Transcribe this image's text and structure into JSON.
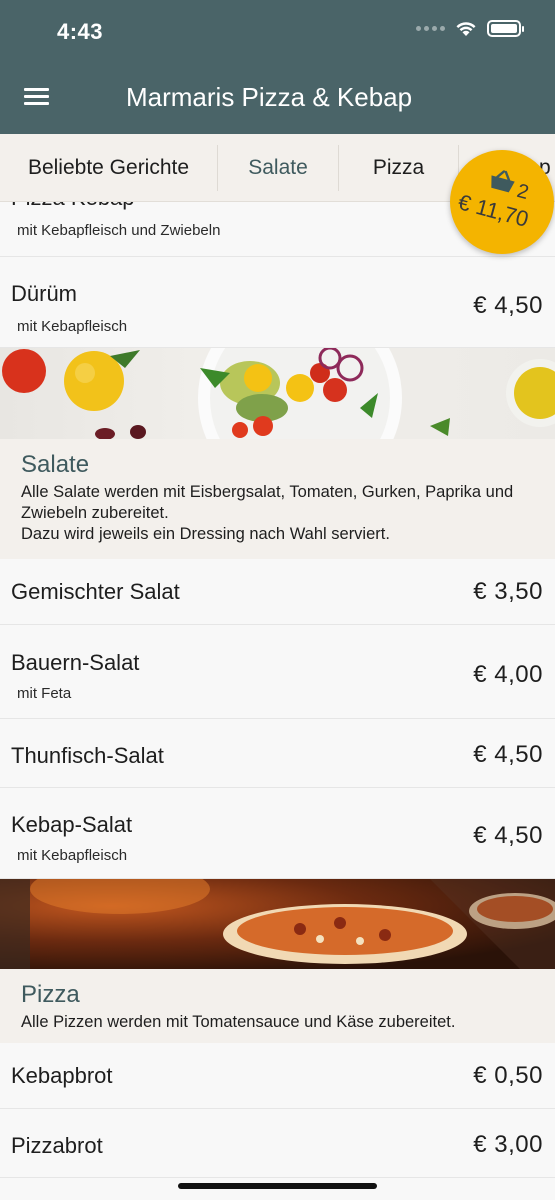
{
  "status_bar": {
    "time": "4:43"
  },
  "app_bar": {
    "title": "Marmaris Pizza & Kebap",
    "menu_icon": "hamburger-menu-icon"
  },
  "tabs": [
    {
      "label": "Beliebte Gerichte"
    },
    {
      "label": "Salate"
    },
    {
      "label": "Pizza"
    },
    {
      "label": "p"
    }
  ],
  "cart": {
    "count": "2",
    "total": "€ 11,70",
    "icon": "basket-icon",
    "color": "#f4b400"
  },
  "colors": {
    "app_bar": "#4a6468",
    "accent": "#3f5a5e",
    "section_bg": "#f3f0ec"
  },
  "popular": {
    "items": [
      {
        "name": "Pizza Kebap",
        "desc": "mit Kebapfleisch und Zwiebeln",
        "price": ""
      },
      {
        "name": "Dürüm",
        "desc": "mit Kebapfleisch",
        "price": "€ 4,50"
      }
    ]
  },
  "salads": {
    "title": "Salate",
    "text": "Alle Salate werden mit Eisbergsalat, Tomaten, Gurken, Paprika und Zwiebeln zubereitet.\nDazu wird jeweils ein Dressing nach Wahl serviert.",
    "items": [
      {
        "name": "Gemischter Salat",
        "desc": "",
        "price": "€ 3,50"
      },
      {
        "name": "Bauern-Salat",
        "desc": "mit Feta",
        "price": "€ 4,00"
      },
      {
        "name": "Thunfisch-Salat",
        "desc": "",
        "price": "€ 4,50"
      },
      {
        "name": "Kebap-Salat",
        "desc": "mit Kebapfleisch",
        "price": "€ 4,50"
      }
    ]
  },
  "pizza": {
    "title": "Pizza",
    "text": "Alle Pizzen werden mit Tomatensauce und Käse zubereitet.",
    "items": [
      {
        "name": "Kebapbrot",
        "desc": "",
        "price": "€ 0,50"
      },
      {
        "name": "Pizzabrot",
        "desc": "",
        "price": "€ 3,00"
      }
    ]
  }
}
